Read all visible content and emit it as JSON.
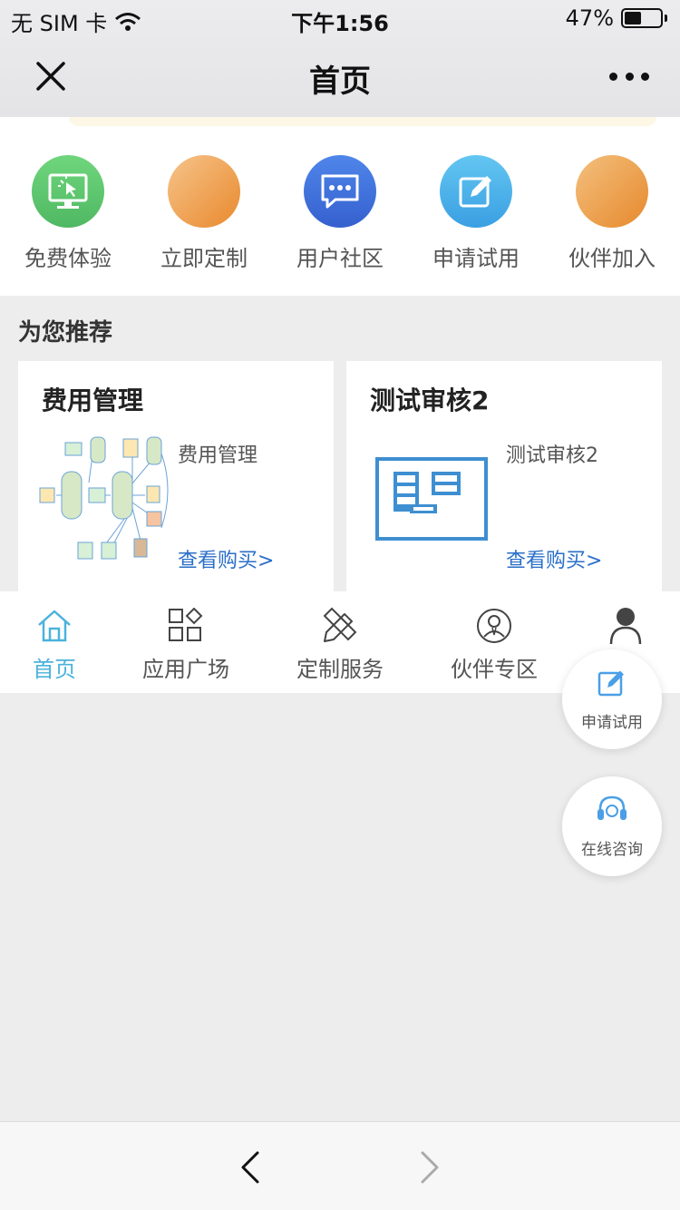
{
  "status_bar": {
    "carrier": "无 SIM 卡",
    "time": "下午1:56",
    "battery": "47%",
    "battery_level": 0.47
  },
  "nav": {
    "title": "首页"
  },
  "quick_access": [
    {
      "label": "免费体验",
      "icon": "monitor-click-icon",
      "color": "#5ec86f"
    },
    {
      "label": "立即定制",
      "icon": "orange-circle-icon",
      "color": "#ef9c40"
    },
    {
      "label": "用户社区",
      "icon": "chat-bubble-icon",
      "color": "#3f6fdc"
    },
    {
      "label": "申请试用",
      "icon": "edit-square-icon",
      "color": "#4ab0ea"
    },
    {
      "label": "伙伴加入",
      "icon": "orange-circle-icon",
      "color": "#ef9c40"
    }
  ],
  "recommend": {
    "title": "为您推荐",
    "cards": [
      {
        "title": "费用管理",
        "desc": "费用管理",
        "link": "查看购买>"
      },
      {
        "title": "测试审核2",
        "desc": "测试审核2",
        "link": "查看购买>"
      }
    ]
  },
  "tabbar": {
    "items": [
      {
        "label": "首页",
        "icon": "home-icon",
        "active": true
      },
      {
        "label": "应用广场",
        "icon": "apps-grid-icon",
        "active": false
      },
      {
        "label": "定制服务",
        "icon": "pencil-ruler-icon",
        "active": false
      },
      {
        "label": "伙伴专区",
        "icon": "partner-icon",
        "active": false
      },
      {
        "label": "",
        "icon": "user-icon",
        "active": false
      }
    ]
  },
  "floating": {
    "apply": {
      "label": "申请试用",
      "icon": "edit-square-icon"
    },
    "consult": {
      "label": "在线咨询",
      "icon": "headset-icon"
    }
  },
  "colors": {
    "accent": "#4cb2dc",
    "link": "#2a6fc9"
  }
}
